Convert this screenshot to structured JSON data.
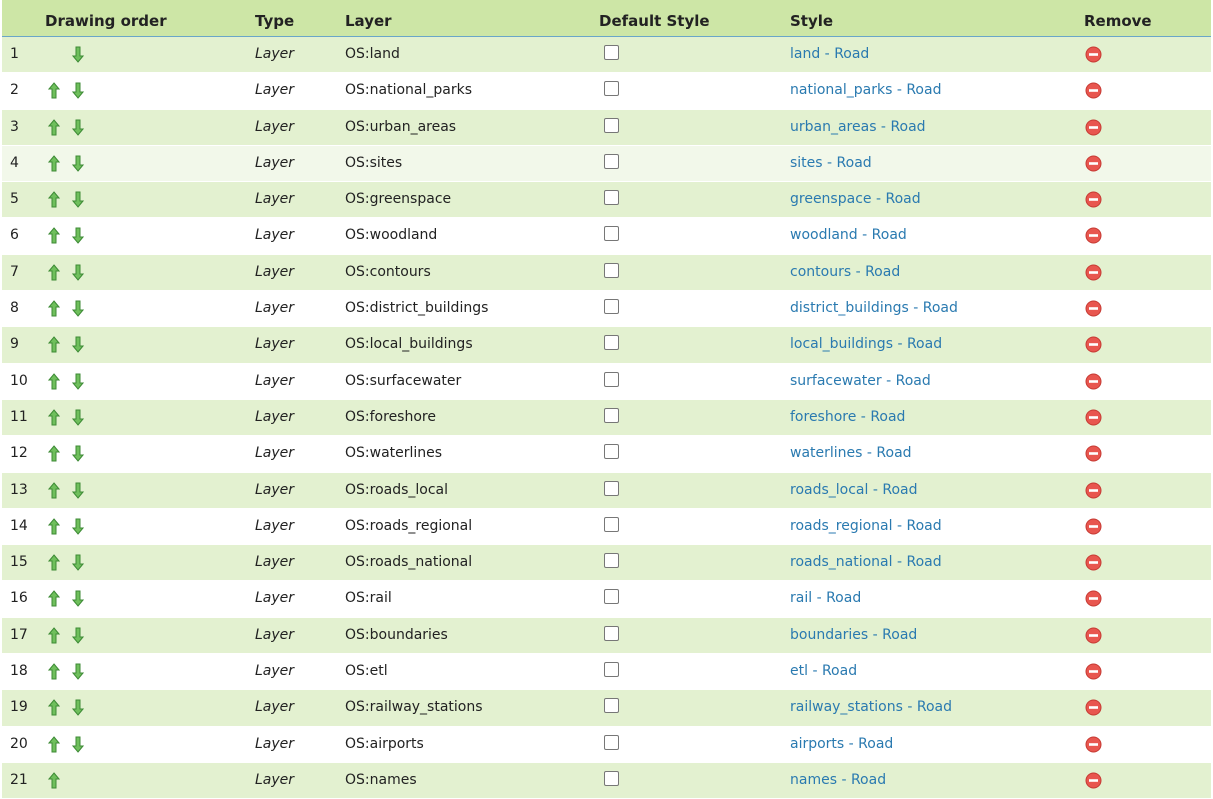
{
  "header": {
    "drawing_order": "Drawing order",
    "type": "Type",
    "layer": "Layer",
    "default_style": "Default Style",
    "style": "Style",
    "remove": "Remove"
  },
  "colors": {
    "header_bg": "#cde6a6",
    "row_alt": "#e3f1d0",
    "link": "#2a7ab0",
    "arrow": "#5aa84a",
    "remove": "#e64b4b"
  },
  "rows": [
    {
      "num": "1",
      "type": "Layer",
      "layer": "OS:land",
      "style_name": "land",
      "style_sep": " - ",
      "style_theme": "Road",
      "up": false,
      "down": true
    },
    {
      "num": "2",
      "type": "Layer",
      "layer": "OS:national_parks",
      "style_name": "national_parks",
      "style_sep": " - ",
      "style_theme": "Road",
      "up": true,
      "down": true
    },
    {
      "num": "3",
      "type": "Layer",
      "layer": "OS:urban_areas",
      "style_name": "urban_areas",
      "style_sep": " - ",
      "style_theme": "Road",
      "up": true,
      "down": true
    },
    {
      "num": "4",
      "type": "Layer",
      "layer": "OS:sites",
      "style_name": "sites",
      "style_sep": " - ",
      "style_theme": "Road",
      "up": true,
      "down": true
    },
    {
      "num": "5",
      "type": "Layer",
      "layer": "OS:greenspace",
      "style_name": "greenspace",
      "style_sep": " - ",
      "style_theme": "Road",
      "up": true,
      "down": true
    },
    {
      "num": "6",
      "type": "Layer",
      "layer": "OS:woodland",
      "style_name": "woodland",
      "style_sep": " - ",
      "style_theme": "Road",
      "up": true,
      "down": true
    },
    {
      "num": "7",
      "type": "Layer",
      "layer": "OS:contours",
      "style_name": "contours",
      "style_sep": " - ",
      "style_theme": "Road",
      "up": true,
      "down": true
    },
    {
      "num": "8",
      "type": "Layer",
      "layer": "OS:district_buildings",
      "style_name": "district_buildings",
      "style_sep": " - ",
      "style_theme": "Road",
      "up": true,
      "down": true
    },
    {
      "num": "9",
      "type": "Layer",
      "layer": "OS:local_buildings",
      "style_name": "local_buildings",
      "style_sep": " - ",
      "style_theme": "Road",
      "up": true,
      "down": true
    },
    {
      "num": "10",
      "type": "Layer",
      "layer": "OS:surfacewater",
      "style_name": "surfacewater",
      "style_sep": " - ",
      "style_theme": "Road",
      "up": true,
      "down": true
    },
    {
      "num": "11",
      "type": "Layer",
      "layer": "OS:foreshore",
      "style_name": "foreshore",
      "style_sep": " - ",
      "style_theme": "Road",
      "up": true,
      "down": true
    },
    {
      "num": "12",
      "type": "Layer",
      "layer": "OS:waterlines",
      "style_name": "waterlines",
      "style_sep": " - ",
      "style_theme": "Road",
      "up": true,
      "down": true
    },
    {
      "num": "13",
      "type": "Layer",
      "layer": "OS:roads_local",
      "style_name": "roads_local",
      "style_sep": " - ",
      "style_theme": "Road",
      "up": true,
      "down": true
    },
    {
      "num": "14",
      "type": "Layer",
      "layer": "OS:roads_regional",
      "style_name": "roads_regional",
      "style_sep": " - ",
      "style_theme": "Road",
      "up": true,
      "down": true
    },
    {
      "num": "15",
      "type": "Layer",
      "layer": "OS:roads_national",
      "style_name": "roads_national",
      "style_sep": " - ",
      "style_theme": "Road",
      "up": true,
      "down": true
    },
    {
      "num": "16",
      "type": "Layer",
      "layer": "OS:rail",
      "style_name": "rail",
      "style_sep": " - ",
      "style_theme": "Road",
      "up": true,
      "down": true
    },
    {
      "num": "17",
      "type": "Layer",
      "layer": "OS:boundaries",
      "style_name": "boundaries",
      "style_sep": " - ",
      "style_theme": "Road",
      "up": true,
      "down": true
    },
    {
      "num": "18",
      "type": "Layer",
      "layer": "OS:etl",
      "style_name": "etl",
      "style_sep": " - ",
      "style_theme": "Road",
      "up": true,
      "down": true
    },
    {
      "num": "19",
      "type": "Layer",
      "layer": "OS:railway_stations",
      "style_name": "railway_stations",
      "style_sep": " - ",
      "style_theme": "Road",
      "up": true,
      "down": true
    },
    {
      "num": "20",
      "type": "Layer",
      "layer": "OS:airports",
      "style_name": "airports",
      "style_sep": " - ",
      "style_theme": "Road",
      "up": true,
      "down": true
    },
    {
      "num": "21",
      "type": "Layer",
      "layer": "OS:names",
      "style_name": "names",
      "style_sep": " - ",
      "style_theme": "Road",
      "up": true,
      "down": false
    }
  ]
}
